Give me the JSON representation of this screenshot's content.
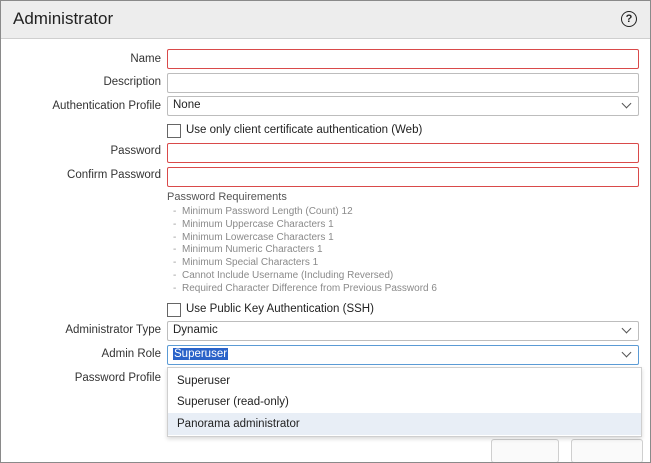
{
  "dialog": {
    "title": "Administrator",
    "help_icon": "help-circle-icon"
  },
  "form": {
    "name_label": "Name",
    "name_value": "",
    "description_label": "Description",
    "description_value": "",
    "auth_profile_label": "Authentication Profile",
    "auth_profile_value": "None",
    "client_cert_checkbox_label": "Use only client certificate authentication (Web)",
    "client_cert_checked": false,
    "password_label": "Password",
    "password_value": "",
    "confirm_password_label": "Confirm Password",
    "confirm_password_value": "",
    "pw_requirements_heading": "Password Requirements",
    "pw_requirements": [
      "Minimum Password Length (Count) 12",
      "Minimum Uppercase Characters 1",
      "Minimum Lowercase Characters 1",
      "Minimum Numeric Characters 1",
      "Minimum Special Characters 1",
      "Cannot Include Username (Including Reversed)",
      "Required Character Difference from Previous Password 6"
    ],
    "ssh_checkbox_label": "Use Public Key Authentication (SSH)",
    "ssh_checked": false,
    "admin_type_label": "Administrator Type",
    "admin_type_value": "Dynamic",
    "admin_role_label": "Admin Role",
    "admin_role_value": "Superuser",
    "password_profile_label": "Password Profile"
  },
  "admin_role_dropdown": {
    "options": [
      "Superuser",
      "Superuser (read-only)",
      "Panorama administrator"
    ],
    "hovered_index": 2
  },
  "colors": {
    "invalid_border": "#d94a4a",
    "selection_highlight": "#2a63c9",
    "hover_row": "#e8eef6"
  }
}
